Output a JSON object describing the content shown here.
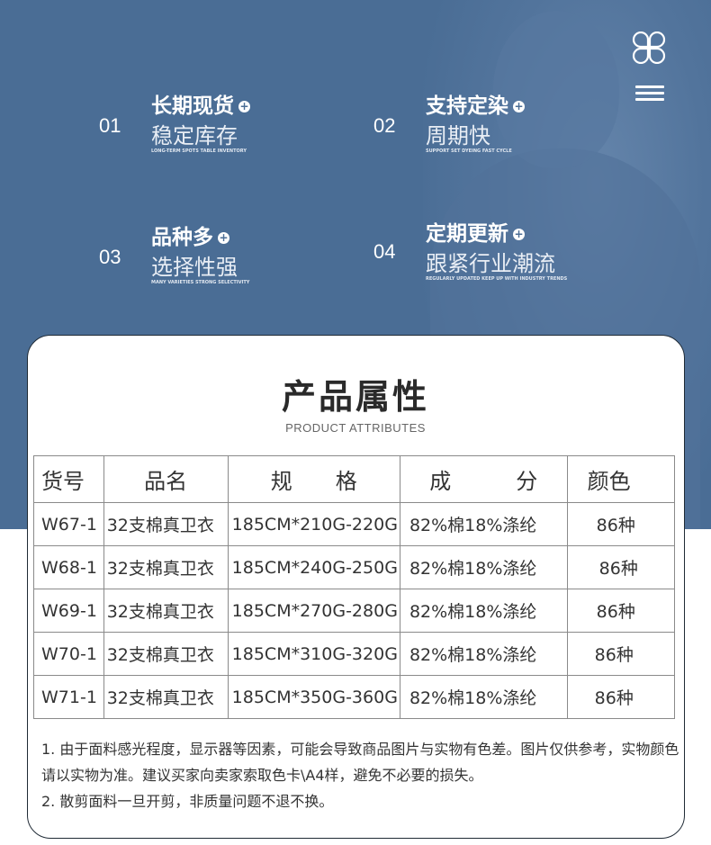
{
  "hero": {
    "features": [
      {
        "num": "01",
        "title": "长期现货",
        "subtitle": "稳定库存",
        "english": "LONG-TERM SPOTS TABLE INVENTORY"
      },
      {
        "num": "02",
        "title": "支持定染",
        "subtitle": "周期快",
        "english": "SUPPORT SET DYEING FAST CYCLE"
      },
      {
        "num": "03",
        "title": "品种多",
        "subtitle": "选择性强",
        "english": "MANY VARIETIES STRONG SELECTIVITY"
      },
      {
        "num": "04",
        "title": "定期更新",
        "subtitle": "跟紧行业潮流",
        "english": "REGULARLY UPDATED KEEP UP WITH INDUSTRY TRENDS"
      }
    ],
    "plus_glyph": "+"
  },
  "section": {
    "title": "产品属性",
    "subtitle": "PRODUCT ATTRIBUTES"
  },
  "table": {
    "headers": [
      "货号",
      "品名",
      "规　　格",
      "成　　　分",
      "颜色"
    ],
    "rows": [
      [
        "W67-1",
        "32支棉真卫衣",
        "185CM*210G-220G",
        "82%棉18%涤纶",
        "86种"
      ],
      [
        "W68-1",
        "32支棉真卫衣",
        "185CM*240G-250G",
        "82%棉18%涤纶",
        "86种"
      ],
      [
        "W69-1",
        "32支棉真卫衣",
        "185CM*270G-280G",
        "82%棉18%涤纶",
        "86种"
      ],
      [
        "W70-1",
        "32支棉真卫衣",
        "185CM*310G-320G",
        "82%棉18%涤纶",
        "86种"
      ],
      [
        "W71-1",
        "32支棉真卫衣",
        "185CM*350G-360G",
        "82%棉18%涤纶",
        "86种"
      ]
    ]
  },
  "notes": [
    "1. 由于面料感光程度，显示器等因素，可能会导致商品图片与实物有色差。图片仅供参考，实物颜色请以实物为准。建议买家向卖家索取色卡\\A4样，避免不必要的损失。",
    "2.   散剪面料一旦开剪，非质量问题不退不换。"
  ],
  "colors": {
    "hero_bg": "#4a6d95",
    "text": "#333333",
    "border": "#8a8a8a"
  },
  "icons": [
    "clover-icon",
    "menu-icon",
    "plus-icon"
  ]
}
